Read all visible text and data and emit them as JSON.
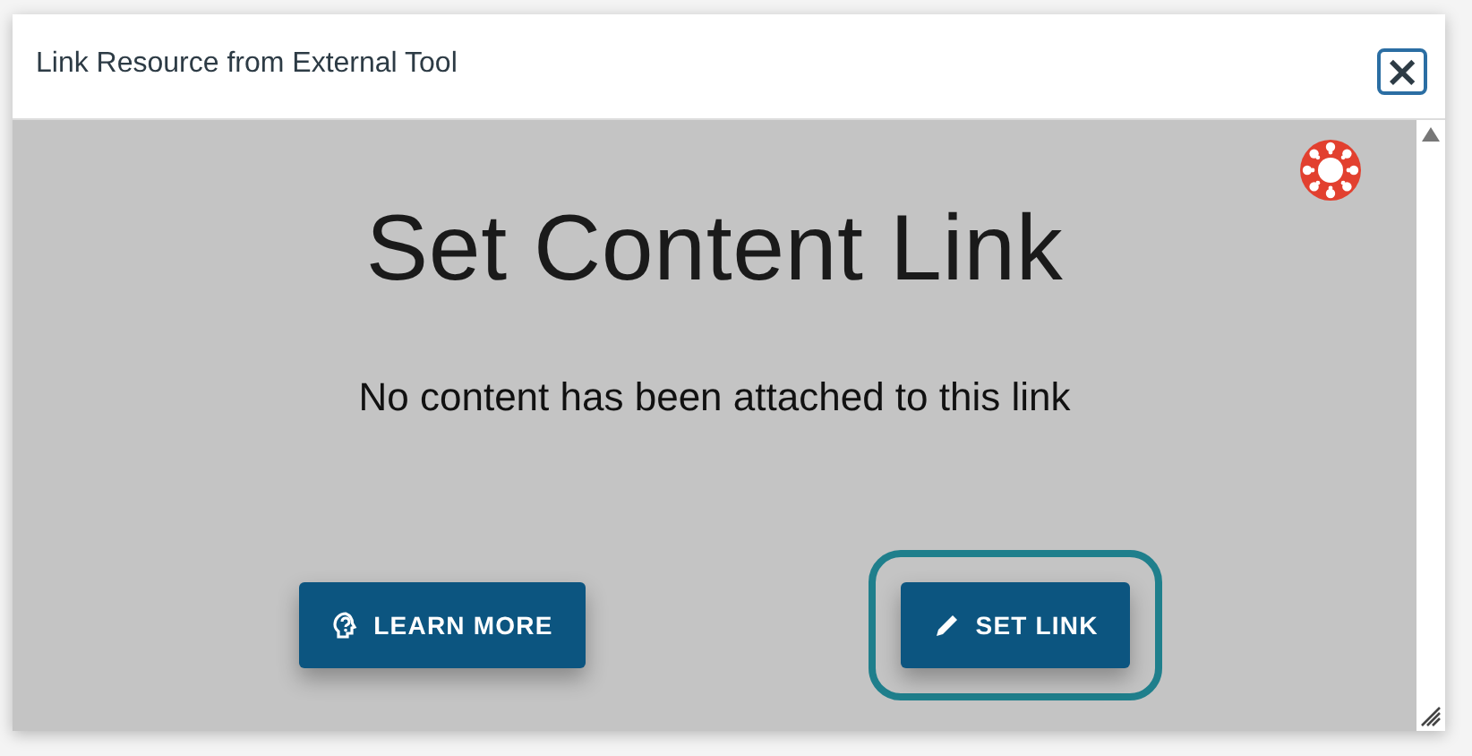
{
  "dialog": {
    "title": "Link Resource from External Tool",
    "close_label": "×"
  },
  "content": {
    "heading": "Set Content Link",
    "message": "No content has been attached to this link"
  },
  "buttons": [
    {
      "kind": "help",
      "label": "LEARN MORE",
      "focused": false
    },
    {
      "kind": "edit",
      "label": "SET LINK",
      "focused": true
    }
  ]
}
